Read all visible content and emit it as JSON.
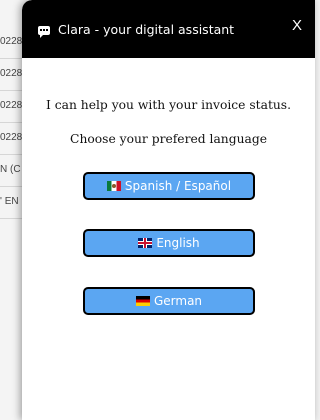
{
  "background_list": {
    "rows": [
      "0228",
      "0228",
      "0228",
      "0228",
      "N (C",
      "' EN"
    ]
  },
  "chat": {
    "icon": "chat-bubble-icon",
    "title": "Clara - your digital assistant",
    "close_label": "X",
    "greeting": "I can help you with your invoice status.",
    "prompt": "Choose your prefered language",
    "buttons": [
      {
        "label": "Spanish / Español",
        "flag": "mexico-flag-icon"
      },
      {
        "label": "English",
        "flag": "uk-flag-icon"
      },
      {
        "label": "German",
        "flag": "germany-flag-icon"
      }
    ],
    "colors": {
      "header": "#000000",
      "button": "#5ba6f2",
      "button_border": "#000000",
      "button_text": "#ffffff"
    }
  }
}
